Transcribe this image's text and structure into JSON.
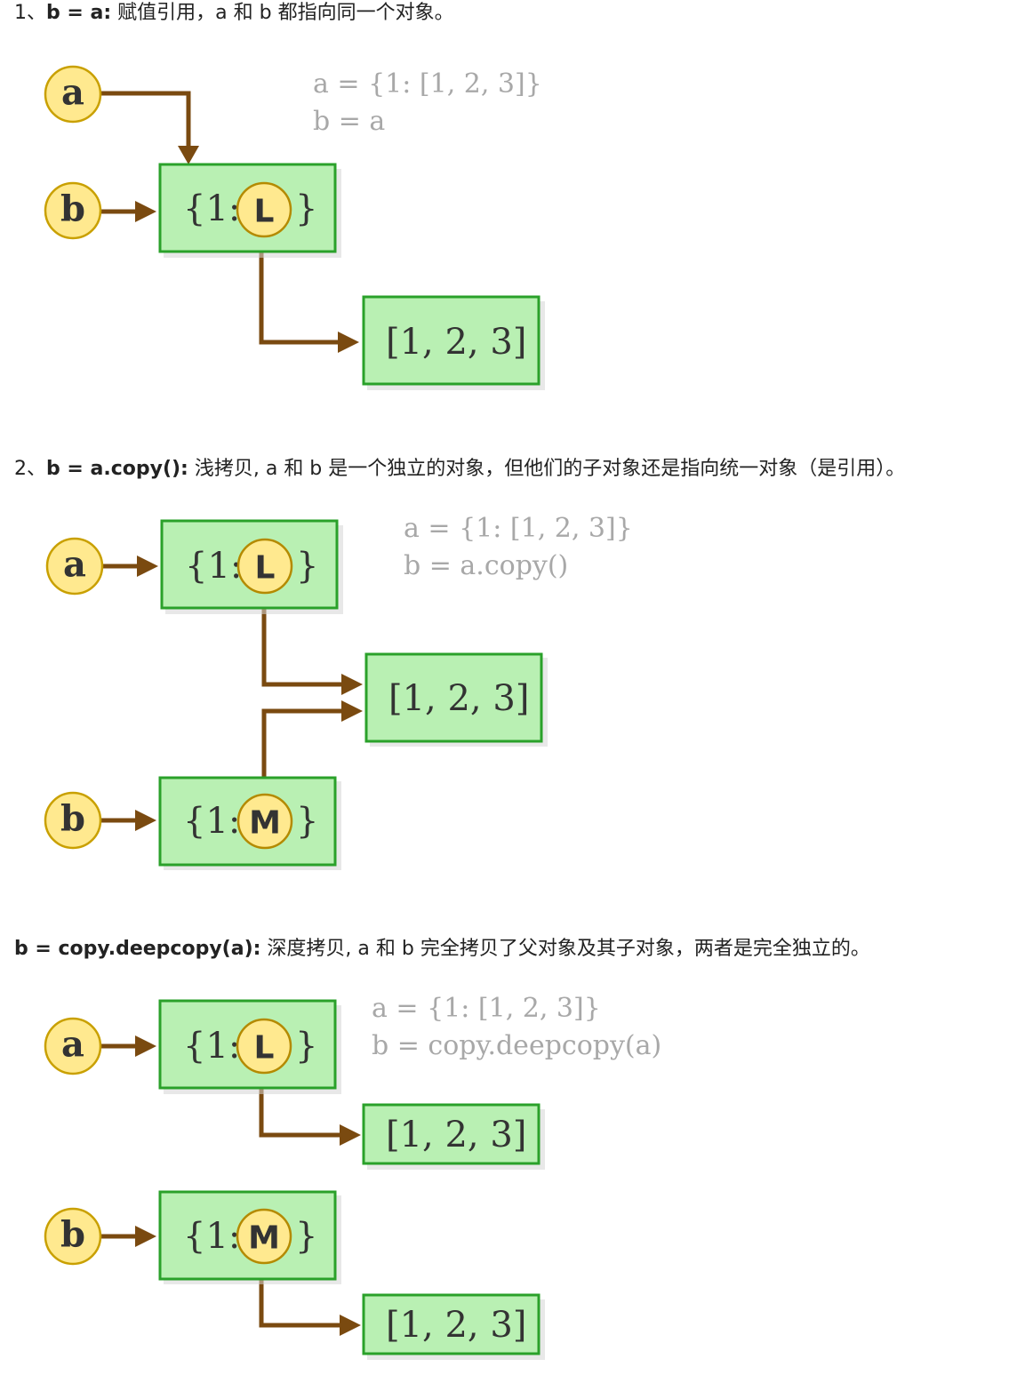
{
  "sections": [
    {
      "heading": {
        "lead": "1、",
        "code": "b = a:",
        "desc": " 赋值引用，a 和 b 都指向同一个对象。"
      },
      "code_lines": [
        "a = {1: [1, 2, 3]}",
        "b = a"
      ],
      "variables": [
        "a",
        "b"
      ],
      "dict_boxes": [
        {
          "prefix": "{1:",
          "ref": "L",
          "suffix": "}"
        }
      ],
      "list_boxes": [
        {
          "text": "[1, 2, 3]"
        }
      ]
    },
    {
      "heading": {
        "lead": "2、",
        "code": "b = a.copy():",
        "desc": " 浅拷贝, a 和 b 是一个独立的对象，但他们的子对象还是指向统一对象（是引用）。"
      },
      "code_lines": [
        "a = {1: [1, 2, 3]}",
        "b = a.copy()"
      ],
      "variables": [
        "a",
        "b"
      ],
      "dict_boxes": [
        {
          "prefix": "{1:",
          "ref": "L",
          "suffix": "}"
        },
        {
          "prefix": "{1:",
          "ref": "M",
          "suffix": "}"
        }
      ],
      "list_boxes": [
        {
          "text": "[1, 2, 3]"
        }
      ]
    },
    {
      "heading": {
        "lead": "",
        "code": "b = copy.deepcopy(a):",
        "desc": " 深度拷贝, a 和 b 完全拷贝了父对象及其子对象，两者是完全独立的。"
      },
      "code_lines": [
        "a = {1: [1, 2, 3]}",
        "b = copy.deepcopy(a)"
      ],
      "variables": [
        "a",
        "b"
      ],
      "dict_boxes": [
        {
          "prefix": "{1:",
          "ref": "L",
          "suffix": "}"
        },
        {
          "prefix": "{1:",
          "ref": "M",
          "suffix": "}"
        }
      ],
      "list_boxes": [
        {
          "text": "[1, 2, 3]"
        },
        {
          "text": "[1, 2, 3]"
        }
      ]
    }
  ],
  "colors": {
    "box_fill": "#b9f0b3",
    "box_border": "#2aa12a",
    "node_fill": "#ffe98f",
    "node_border": "#c9a000",
    "arrow": "#7a4a10",
    "code_text": "#a8a8a8"
  }
}
